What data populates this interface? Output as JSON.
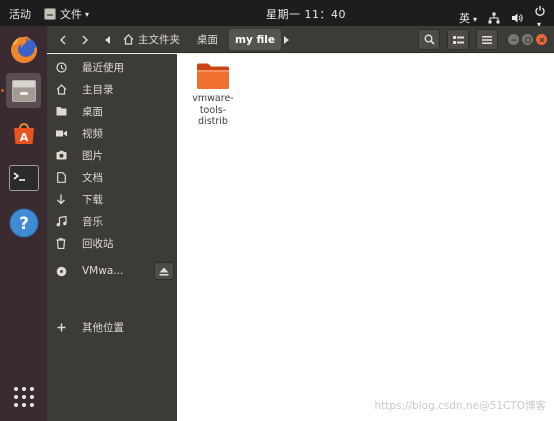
{
  "top_panel": {
    "activities": "活动",
    "app_name": "文件",
    "clock": "星期一 11：40",
    "input_method": "英"
  },
  "dock": {
    "items": [
      {
        "name": "Firefox",
        "icon": "firefox-icon"
      },
      {
        "name": "Files",
        "icon": "files-icon",
        "active": true
      },
      {
        "name": "Ubuntu Software",
        "icon": "software-store-icon"
      },
      {
        "name": "Terminal",
        "icon": "terminal-icon"
      },
      {
        "name": "Help",
        "icon": "help-icon"
      },
      {
        "name": "Show Applications",
        "icon": "app-grid-icon"
      }
    ],
    "accent": "#e95420"
  },
  "headerbar": {
    "breadcrumb": [
      "主文件夹",
      "桌面",
      "my file"
    ]
  },
  "sidebar": {
    "items": [
      {
        "label": "最近使用",
        "icon": "clock-icon"
      },
      {
        "label": "主目录",
        "icon": "home-icon"
      },
      {
        "label": "桌面",
        "icon": "folder-icon"
      },
      {
        "label": "视频",
        "icon": "video-icon"
      },
      {
        "label": "图片",
        "icon": "camera-icon"
      },
      {
        "label": "文档",
        "icon": "document-icon"
      },
      {
        "label": "下载",
        "icon": "download-icon"
      },
      {
        "label": "音乐",
        "icon": "music-icon"
      },
      {
        "label": "回收站",
        "icon": "trash-icon"
      }
    ],
    "device": {
      "label": "VMwa...",
      "icon": "disc-icon",
      "eject_icon": "eject-icon"
    },
    "other_locations": {
      "label": "其他位置",
      "icon": "plus-icon"
    }
  },
  "content": {
    "files": [
      {
        "name": "vmware-\ntools-\ndistrib",
        "icon": "orange-folder-icon"
      }
    ]
  },
  "watermark": "https://blog.csdn.ne@51CTO博客"
}
